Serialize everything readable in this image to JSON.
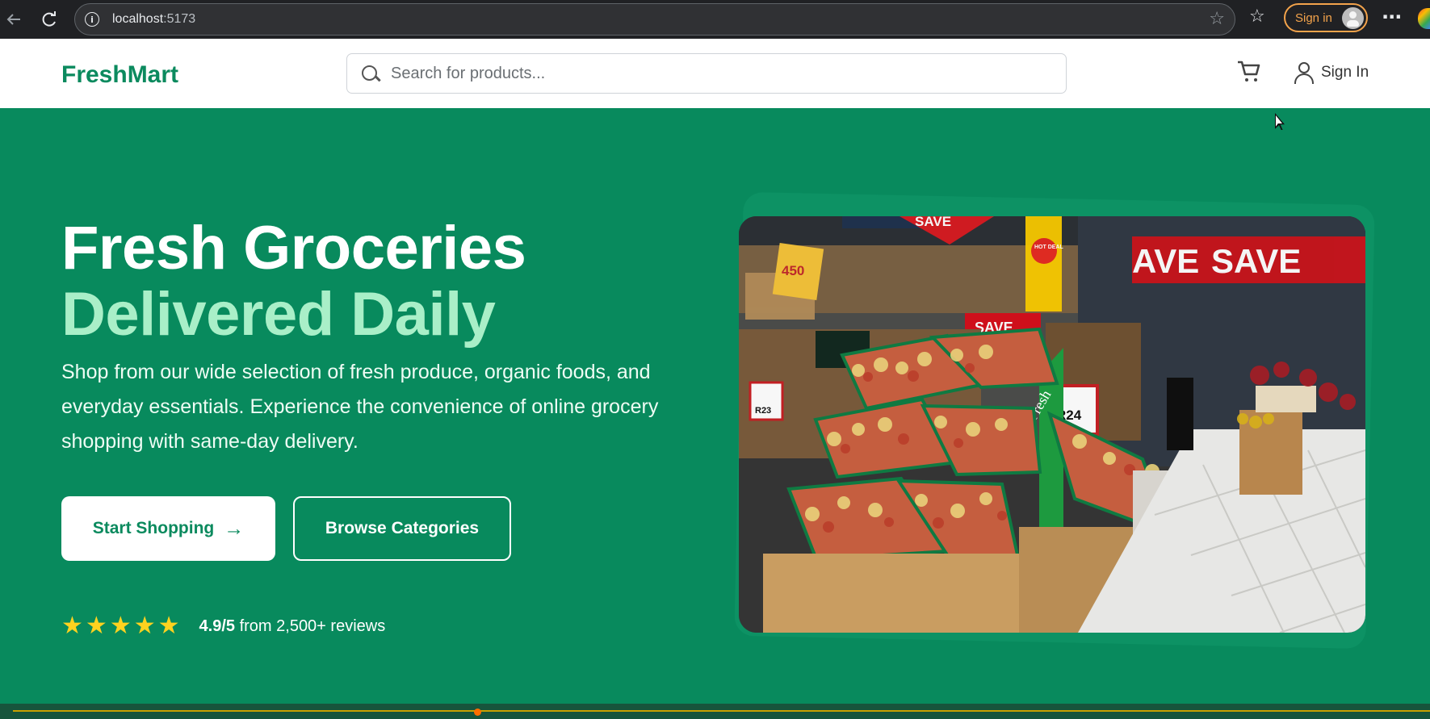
{
  "browser": {
    "url_host": "localhost",
    "url_port": ":5173",
    "signin_label": "Sign in"
  },
  "header": {
    "logo": "FreshMart",
    "search_placeholder": "Search for products...",
    "signin_label": "Sign In"
  },
  "hero": {
    "title_line_1": "Fresh Groceries",
    "title_line_2": "Delivered Daily",
    "description": "Shop from our wide selection of fresh produce, organic foods, and everyday essentials. Experience the convenience of online grocery shopping with same-day delivery.",
    "primary_button": "Start Shopping",
    "secondary_button": "Browse Categories",
    "rating_score": "4.9/5",
    "rating_text": "from 2,500+ reviews",
    "rating_stars": 5
  },
  "store_image": {
    "text": {
      "save_sign": "SAVE",
      "save_banner_1": "AVE",
      "save_banner_2": "SAVE",
      "small_save": "SAVE",
      "hot_sale": "HOT DEAL",
      "fresh_sign": "Fresh",
      "price_1": "R23",
      "price_2": "R24"
    }
  }
}
